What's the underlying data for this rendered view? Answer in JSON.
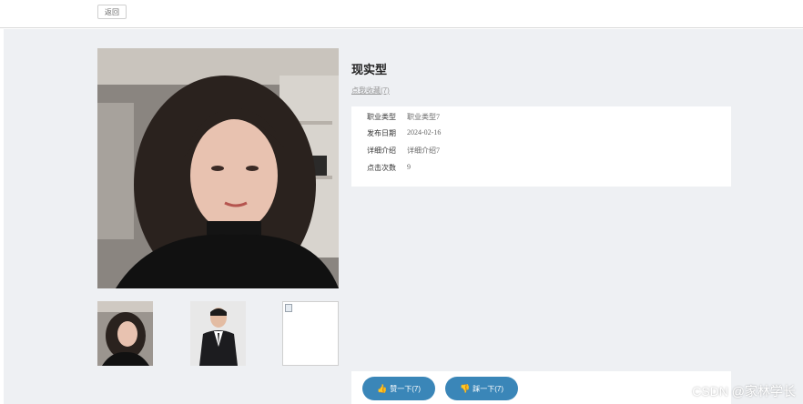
{
  "topbar": {
    "back_label": "返回"
  },
  "detail": {
    "title": "现实型",
    "favorite_link": "点我收藏(7)",
    "fields": [
      {
        "label": "职业类型",
        "value": "职业类型7"
      },
      {
        "label": "发布日期",
        "value": "2024-02-16"
      },
      {
        "label": "详细介绍",
        "value": "详细介绍7"
      },
      {
        "label": "点击次数",
        "value": "9"
      }
    ]
  },
  "actions": {
    "like_label": "赞一下(7)",
    "dislike_label": "踩一下(7)"
  },
  "watermark": "CSDN @家林学长",
  "colors": {
    "accent": "#3a86b8",
    "page_bg": "#eef0f3"
  },
  "icons": {
    "like": "thumbs-up-icon",
    "dislike": "thumbs-down-icon",
    "broken_image": "broken-image-icon"
  }
}
